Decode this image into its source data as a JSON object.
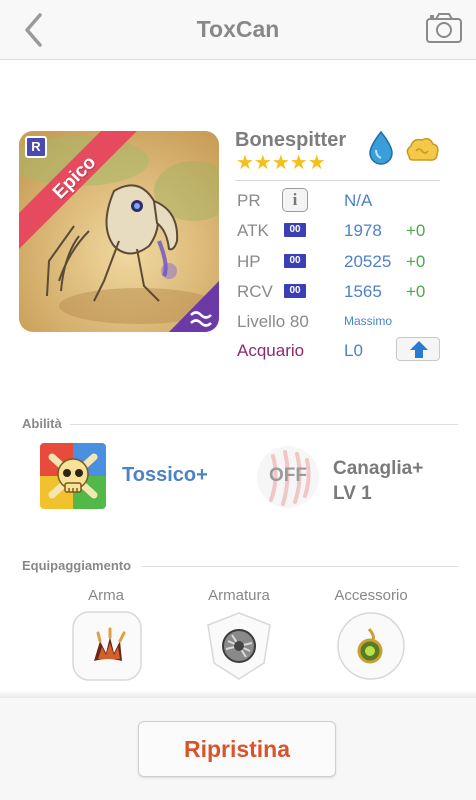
{
  "header": {
    "title": "ToxCan",
    "back_icon": "chevron-left-icon",
    "camera_icon": "camera-icon"
  },
  "monster": {
    "rarity": "Epico",
    "rarity_badge": "R",
    "name": "Bonespitter",
    "stars": 5,
    "stars_text": "★★★★★",
    "elements": [
      "water-drop-icon",
      "wind-cloud-icon"
    ],
    "stats": {
      "pr": {
        "label": "PR",
        "value": "N/A"
      },
      "atk": {
        "label": "ATK",
        "badge": "00",
        "value": "1978",
        "bonus": "+0"
      },
      "hp": {
        "label": "HP",
        "badge": "00",
        "value": "20525",
        "bonus": "+0"
      },
      "rcv": {
        "label": "RCV",
        "badge": "00",
        "value": "1565",
        "bonus": "+0"
      }
    },
    "level": {
      "label": "Livello 80",
      "status": "Massimo"
    },
    "aquarium": {
      "label": "Acquario",
      "value": "L0"
    }
  },
  "abilities": {
    "section_label": "Abilità",
    "skill": {
      "name": "Tossico+"
    },
    "leader": {
      "badge": "OFF",
      "name": "Canaglia+",
      "level": "LV 1"
    }
  },
  "equipment": {
    "section_label": "Equipaggiamento",
    "slots": [
      {
        "label": "Arma",
        "icon": "claw-weapon-icon"
      },
      {
        "label": "Armatura",
        "icon": "armor-shield-icon"
      },
      {
        "label": "Accessorio",
        "icon": "amulet-icon"
      }
    ]
  },
  "footer": {
    "reset_label": "Ripristina"
  },
  "colors": {
    "accent_blue": "#4d82c7",
    "bonus_green": "#4aa84a",
    "reset_orange": "#d8552c",
    "aquarium_purple": "#8b2a6e",
    "star_gold": "#f4c01b"
  }
}
